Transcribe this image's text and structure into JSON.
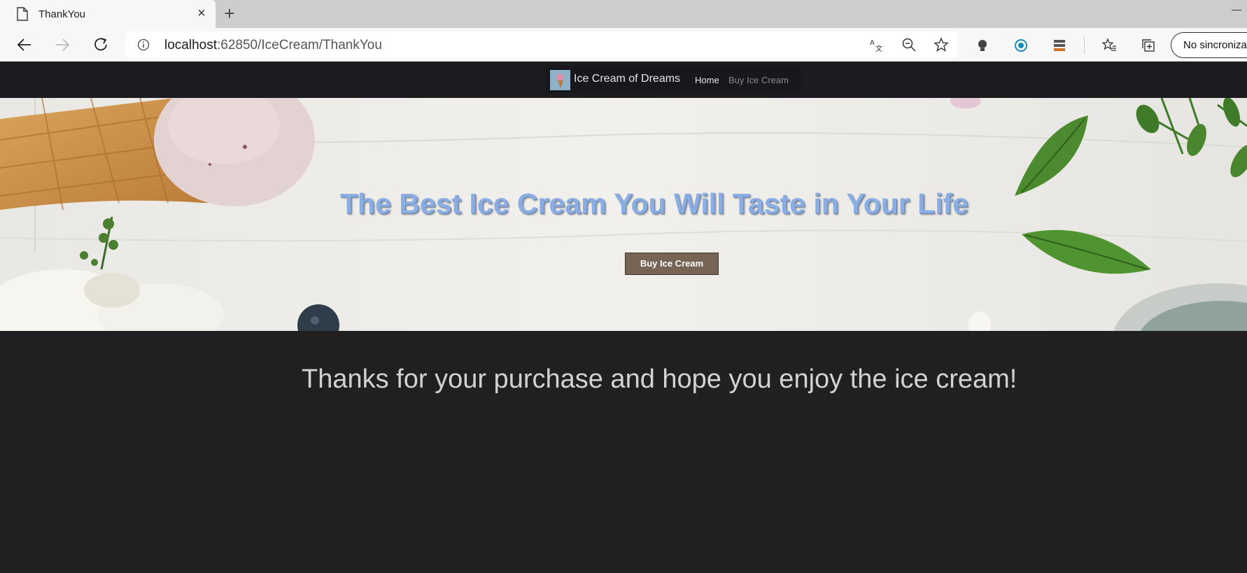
{
  "browser": {
    "tab_title": "ThankYou",
    "tab_close": "×",
    "new_tab": "+",
    "url_host": "localhost",
    "url_rest": ":62850/IceCream/ThankYou",
    "profile_button": "No sincronizado",
    "icons": [
      "document-icon",
      "close-icon",
      "plus-icon",
      "back-icon",
      "forward-icon",
      "refresh-icon",
      "info-icon",
      "translate-icon",
      "zoom-out-icon",
      "star-icon",
      "bulb-icon",
      "record-icon",
      "stack-icon",
      "favorites-icon",
      "collections-icon"
    ]
  },
  "navbar": {
    "brand": "Ice Cream of Dreams",
    "links": [
      "Home",
      "Buy Ice Cream"
    ]
  },
  "hero": {
    "title": "The Best Ice Cream You Will Taste in Your Life",
    "button": "Buy Ice Cream",
    "title_color": "#8aaee4",
    "button_color": "#776455"
  },
  "main": {
    "message": "Thanks for your purchase and hope you enjoy the ice cream!"
  },
  "colors": {
    "page_bg": "#202020",
    "navbar_bg": "#1c1c20"
  }
}
